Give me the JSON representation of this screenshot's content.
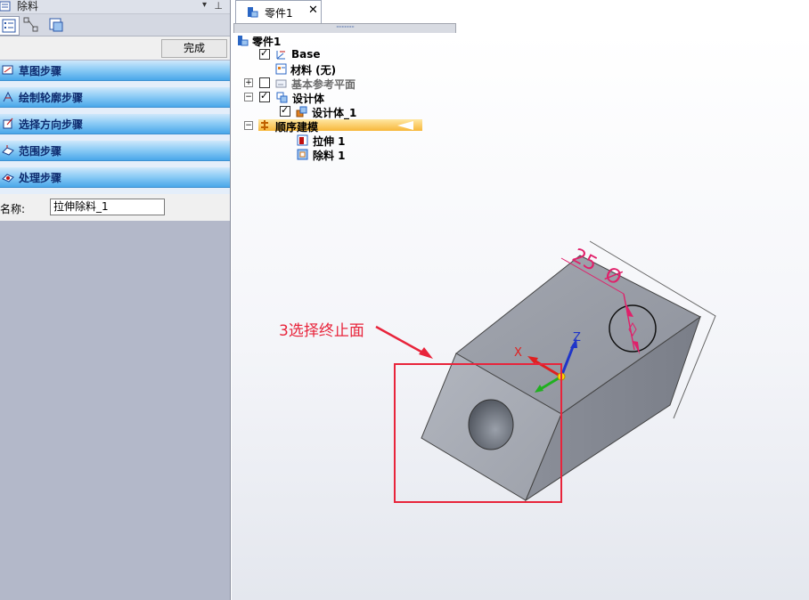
{
  "panel": {
    "title": "除料",
    "pin_glyph": "⊥",
    "drop_glyph": "▾",
    "done_label": "完成",
    "steps": [
      {
        "label": "草图步骤",
        "icon": "sketch-step-icon"
      },
      {
        "label": "绘制轮廓步骤",
        "icon": "profile-step-icon"
      },
      {
        "label": "选择方向步骤",
        "icon": "direction-step-icon"
      },
      {
        "label": "范围步骤",
        "icon": "extent-step-icon"
      },
      {
        "label": "处理步骤",
        "icon": "treatment-step-icon"
      }
    ],
    "name_label": "名称:",
    "name_value": "拉伸除料_1"
  },
  "document": {
    "tab_label": "零件1",
    "close_glyph": "✕",
    "splitter_glyph": "·············"
  },
  "tree": {
    "root": "零件1",
    "base": "Base",
    "material": "材料 (无)",
    "ref_planes": "基本参考平面",
    "design_body": "设计体",
    "design_body_1": "设计体_1",
    "ordered": "顺序建模",
    "extrude": "拉伸 1",
    "cutout": "除料 1",
    "expand_glyph": "+",
    "collapse_glyph": "−"
  },
  "model": {
    "dimension_value": "25",
    "diameter_symbol": "Ø",
    "axis_x": "X",
    "axis_z": "Z"
  },
  "annotation": {
    "text": "3选择终止面",
    "color": "#e8243b"
  },
  "colors": {
    "step_bar": "#5aaeea",
    "highlight": "#f7b73a",
    "dimension": "#e0206a",
    "body": "#9ea3ad"
  }
}
